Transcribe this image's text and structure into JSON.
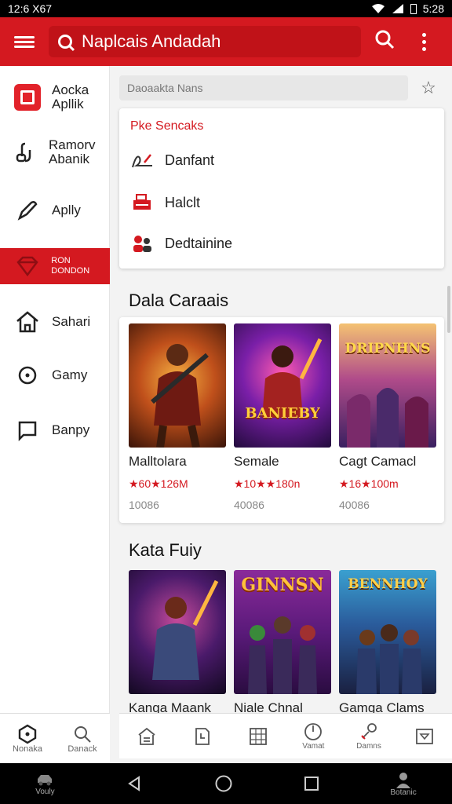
{
  "status": {
    "time": "12:6 X67",
    "clock": "5:28"
  },
  "appbar": {
    "search_text": "Naplcais Andadah"
  },
  "sidebar": {
    "items": [
      {
        "label": "Aocka Apllik"
      },
      {
        "label": "Ramorv Abanik"
      },
      {
        "label": "Aplly"
      },
      {
        "label": "RON DONDON"
      },
      {
        "label": "Sahari"
      },
      {
        "label": "Gamy"
      },
      {
        "label": "Banpy"
      }
    ]
  },
  "filter": {
    "placeholder": "Daoaakta Nans"
  },
  "dropdown": {
    "header": "Pke Sencaks",
    "items": [
      {
        "label": "Danfant"
      },
      {
        "label": "Halclt"
      },
      {
        "label": "Dedtainine"
      }
    ]
  },
  "section1": {
    "title": "Dala Caraais",
    "games": [
      {
        "name": "Malltolara",
        "rating": "★60★126M",
        "downloads": "10086"
      },
      {
        "name": "Semale",
        "rating": "★10★★180n",
        "downloads": "40086"
      },
      {
        "name": "Cagt Camacl",
        "rating": "★16★100m",
        "downloads": "40086"
      }
    ]
  },
  "section2": {
    "title": "Kata Fuiy",
    "games": [
      {
        "name": "Kanga Maank",
        "art": ""
      },
      {
        "name": "Niale Chnal",
        "art": "GINNSN"
      },
      {
        "name": "Gamga Clams",
        "art": "BENNHOY"
      }
    ]
  },
  "card_art": {
    "s1_1": "",
    "s1_2": "BANIEBY",
    "s1_3": "DRIPNHNS"
  },
  "tabs": [
    {
      "label": ""
    },
    {
      "label": ""
    },
    {
      "label": ""
    },
    {
      "label": "Vamat"
    },
    {
      "label": "Damns"
    },
    {
      "label": ""
    }
  ],
  "leftnav": [
    {
      "label": "Nonaka"
    },
    {
      "label": "Danack"
    }
  ],
  "sysnav": {
    "left_label": "Vouly",
    "right_label": "Botanic"
  },
  "colors": {
    "brand": "#d41920",
    "star": "#f0a000"
  }
}
